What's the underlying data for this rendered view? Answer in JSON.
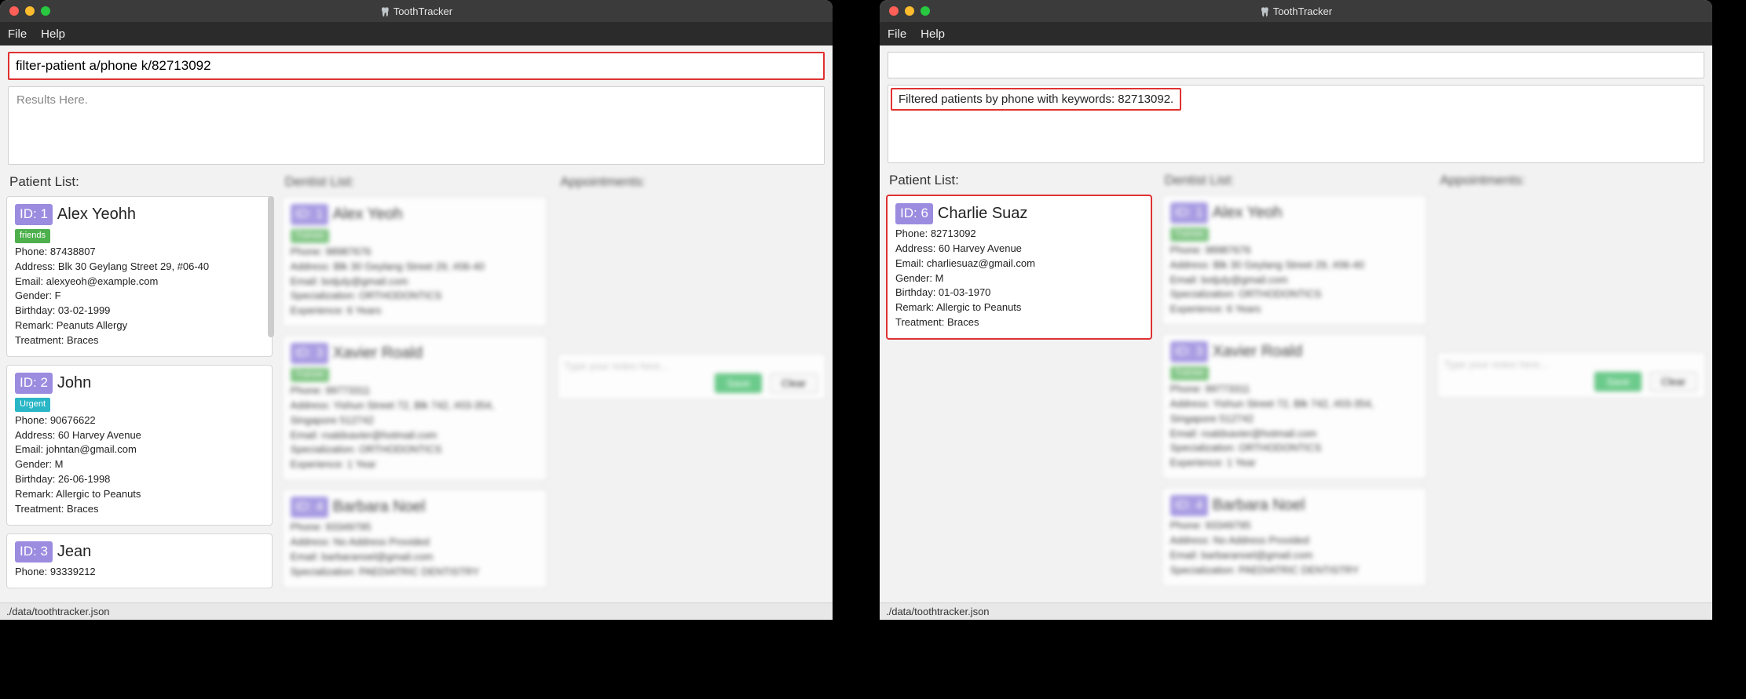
{
  "app_title": "ToothTracker",
  "menu": {
    "file": "File",
    "help": "Help"
  },
  "footer_path": "./data/toothtracker.json",
  "left_window": {
    "command_input": "filter-patient a/phone k/82713092",
    "results_placeholder": "Results Here.",
    "columns": {
      "patient_title": "Patient List:",
      "dentist_title": "Dentist List:",
      "appointments_title": "Appointments:"
    },
    "patients": [
      {
        "id": "ID: 1",
        "name": "Alex Yeohh",
        "tag": "friends",
        "tag_class": "friends",
        "phone": "Phone: 87438807",
        "address": "Address: Blk 30 Geylang Street 29, #06-40",
        "email": "Email: alexyeoh@example.com",
        "gender": "Gender: F",
        "birthday": "Birthday: 03-02-1999",
        "remark": "Remark: Peanuts Allergy",
        "treatment": "Treatment: Braces"
      },
      {
        "id": "ID: 2",
        "name": "John",
        "tag": "Urgent",
        "tag_class": "urgent",
        "phone": "Phone: 90676622",
        "address": "Address: 60 Harvey Avenue",
        "email": "Email: johntan@gmail.com",
        "gender": "Gender: M",
        "birthday": "Birthday: 26-06-1998",
        "remark": "Remark: Allergic to Peanuts",
        "treatment": "Treatment: Braces"
      },
      {
        "id": "ID: 3",
        "name": "Jean",
        "tag": "",
        "tag_class": "",
        "phone": "Phone: 93339212",
        "address": "",
        "email": "",
        "gender": "",
        "birthday": "",
        "remark": "",
        "treatment": ""
      }
    ],
    "dentists": [
      {
        "id": "ID: 1",
        "name": "Alex Yeoh",
        "tag": "Trainee",
        "phone": "Phone: 98987676",
        "address": "Address: Blk 30 Geylang Street 29, #06-40",
        "email": "Email: botjuly@gmail.com",
        "spec": "Specialization: ORTHODONTICS",
        "exp": "Experience: 6 Years"
      },
      {
        "id": "ID: 3",
        "name": "Xavier Roald",
        "tag": "Trainee",
        "phone": "Phone: 99773311",
        "address": "Address: Yishun Street 72, Blk 742, #03-354, Singapore 512742",
        "email": "Email: roaldxavier@hotmail.com",
        "spec": "Specialization: ORTHODONTICS",
        "exp": "Experience: 1 Year"
      },
      {
        "id": "ID: 4",
        "name": "Barbara Noel",
        "tag": "",
        "phone": "Phone: 93349795",
        "address": "Address: No Address Provided",
        "email": "Email: barbaranoel@gmail.com",
        "spec": "Specialization: PAEDIATRIC DENTISTRY",
        "exp": ""
      }
    ],
    "notes_placeholder": "Type your notes here...",
    "save_label": "Save",
    "clear_label": "Clear"
  },
  "right_window": {
    "command_input": "",
    "results_message": "Filtered patients by phone with keywords: 82713092.",
    "columns": {
      "patient_title": "Patient List:",
      "dentist_title": "Dentist List:",
      "appointments_title": "Appointments:"
    },
    "patients": [
      {
        "id": "ID: 6",
        "name": "Charlie Suaz",
        "phone": "Phone: 82713092",
        "address": "Address: 60 Harvey Avenue",
        "email": "Email: charliesuaz@gmail.com",
        "gender": "Gender: M",
        "birthday": "Birthday: 01-03-1970",
        "remark": "Remark: Allergic to Peanuts",
        "treatment": "Treatment: Braces"
      }
    ],
    "dentists": [
      {
        "id": "ID: 1",
        "name": "Alex Yeoh",
        "tag": "Trainee",
        "phone": "Phone: 98987676",
        "address": "Address: Blk 30 Geylang Street 29, #06-40",
        "email": "Email: botjuly@gmail.com",
        "spec": "Specialization: ORTHODONTICS",
        "exp": "Experience: 6 Years"
      },
      {
        "id": "ID: 3",
        "name": "Xavier Roald",
        "tag": "Trainee",
        "phone": "Phone: 99773311",
        "address": "Address: Yishun Street 72, Blk 742, #03-354, Singapore 512742",
        "email": "Email: roaldxavier@hotmail.com",
        "spec": "Specialization: ORTHODONTICS",
        "exp": "Experience: 1 Year"
      },
      {
        "id": "ID: 4",
        "name": "Barbara Noel",
        "tag": "",
        "phone": "Phone: 93349795",
        "address": "Address: No Address Provided",
        "email": "Email: barbaranoel@gmail.com",
        "spec": "Specialization: PAEDIATRIC DENTISTRY",
        "exp": ""
      }
    ],
    "notes_placeholder": "Type your notes here...",
    "save_label": "Save",
    "clear_label": "Clear"
  }
}
